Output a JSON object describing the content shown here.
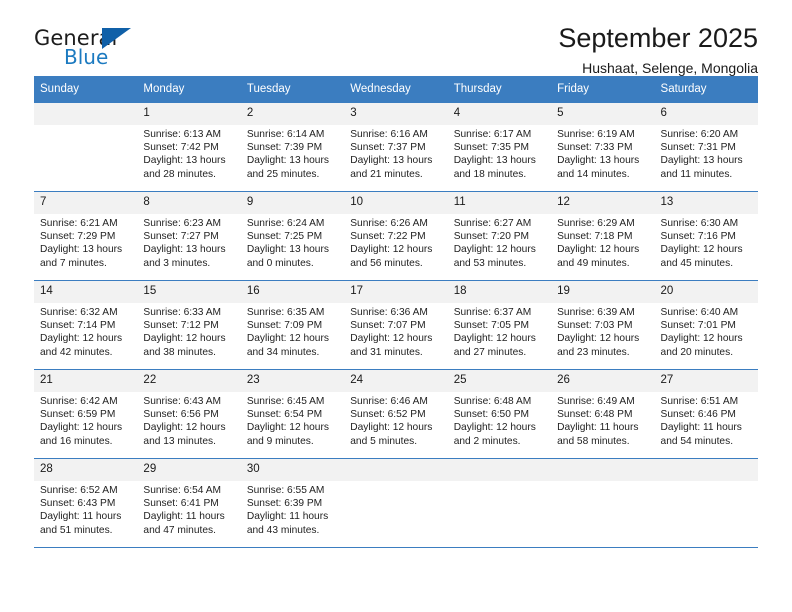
{
  "brand": {
    "name_top": "General",
    "name_bottom": "Blue",
    "accent_color": "#1c7ac0",
    "triangle_color": "#1060a8"
  },
  "header": {
    "title": "September 2025",
    "subtitle": "Hushaat, Selenge, Mongolia"
  },
  "theme": {
    "header_band": "#3b7dc0",
    "daynum_band": "#f2f2f2",
    "text": "#1a1a1a"
  },
  "calendar": {
    "weekday_headers": [
      "Sunday",
      "Monday",
      "Tuesday",
      "Wednesday",
      "Thursday",
      "Friday",
      "Saturday"
    ],
    "labels": {
      "sunrise": "Sunrise:",
      "sunset": "Sunset:",
      "daylight": "Daylight:"
    },
    "weeks": [
      [
        {
          "day": "",
          "empty": true
        },
        {
          "day": "1",
          "sunrise": "Sunrise: 6:13 AM",
          "sunset": "Sunset: 7:42 PM",
          "daylight_1": "Daylight: 13 hours",
          "daylight_2": "and 28 minutes."
        },
        {
          "day": "2",
          "sunrise": "Sunrise: 6:14 AM",
          "sunset": "Sunset: 7:39 PM",
          "daylight_1": "Daylight: 13 hours",
          "daylight_2": "and 25 minutes."
        },
        {
          "day": "3",
          "sunrise": "Sunrise: 6:16 AM",
          "sunset": "Sunset: 7:37 PM",
          "daylight_1": "Daylight: 13 hours",
          "daylight_2": "and 21 minutes."
        },
        {
          "day": "4",
          "sunrise": "Sunrise: 6:17 AM",
          "sunset": "Sunset: 7:35 PM",
          "daylight_1": "Daylight: 13 hours",
          "daylight_2": "and 18 minutes."
        },
        {
          "day": "5",
          "sunrise": "Sunrise: 6:19 AM",
          "sunset": "Sunset: 7:33 PM",
          "daylight_1": "Daylight: 13 hours",
          "daylight_2": "and 14 minutes."
        },
        {
          "day": "6",
          "sunrise": "Sunrise: 6:20 AM",
          "sunset": "Sunset: 7:31 PM",
          "daylight_1": "Daylight: 13 hours",
          "daylight_2": "and 11 minutes."
        }
      ],
      [
        {
          "day": "7",
          "sunrise": "Sunrise: 6:21 AM",
          "sunset": "Sunset: 7:29 PM",
          "daylight_1": "Daylight: 13 hours",
          "daylight_2": "and 7 minutes."
        },
        {
          "day": "8",
          "sunrise": "Sunrise: 6:23 AM",
          "sunset": "Sunset: 7:27 PM",
          "daylight_1": "Daylight: 13 hours",
          "daylight_2": "and 3 minutes."
        },
        {
          "day": "9",
          "sunrise": "Sunrise: 6:24 AM",
          "sunset": "Sunset: 7:25 PM",
          "daylight_1": "Daylight: 13 hours",
          "daylight_2": "and 0 minutes."
        },
        {
          "day": "10",
          "sunrise": "Sunrise: 6:26 AM",
          "sunset": "Sunset: 7:22 PM",
          "daylight_1": "Daylight: 12 hours",
          "daylight_2": "and 56 minutes."
        },
        {
          "day": "11",
          "sunrise": "Sunrise: 6:27 AM",
          "sunset": "Sunset: 7:20 PM",
          "daylight_1": "Daylight: 12 hours",
          "daylight_2": "and 53 minutes."
        },
        {
          "day": "12",
          "sunrise": "Sunrise: 6:29 AM",
          "sunset": "Sunset: 7:18 PM",
          "daylight_1": "Daylight: 12 hours",
          "daylight_2": "and 49 minutes."
        },
        {
          "day": "13",
          "sunrise": "Sunrise: 6:30 AM",
          "sunset": "Sunset: 7:16 PM",
          "daylight_1": "Daylight: 12 hours",
          "daylight_2": "and 45 minutes."
        }
      ],
      [
        {
          "day": "14",
          "sunrise": "Sunrise: 6:32 AM",
          "sunset": "Sunset: 7:14 PM",
          "daylight_1": "Daylight: 12 hours",
          "daylight_2": "and 42 minutes."
        },
        {
          "day": "15",
          "sunrise": "Sunrise: 6:33 AM",
          "sunset": "Sunset: 7:12 PM",
          "daylight_1": "Daylight: 12 hours",
          "daylight_2": "and 38 minutes."
        },
        {
          "day": "16",
          "sunrise": "Sunrise: 6:35 AM",
          "sunset": "Sunset: 7:09 PM",
          "daylight_1": "Daylight: 12 hours",
          "daylight_2": "and 34 minutes."
        },
        {
          "day": "17",
          "sunrise": "Sunrise: 6:36 AM",
          "sunset": "Sunset: 7:07 PM",
          "daylight_1": "Daylight: 12 hours",
          "daylight_2": "and 31 minutes."
        },
        {
          "day": "18",
          "sunrise": "Sunrise: 6:37 AM",
          "sunset": "Sunset: 7:05 PM",
          "daylight_1": "Daylight: 12 hours",
          "daylight_2": "and 27 minutes."
        },
        {
          "day": "19",
          "sunrise": "Sunrise: 6:39 AM",
          "sunset": "Sunset: 7:03 PM",
          "daylight_1": "Daylight: 12 hours",
          "daylight_2": "and 23 minutes."
        },
        {
          "day": "20",
          "sunrise": "Sunrise: 6:40 AM",
          "sunset": "Sunset: 7:01 PM",
          "daylight_1": "Daylight: 12 hours",
          "daylight_2": "and 20 minutes."
        }
      ],
      [
        {
          "day": "21",
          "sunrise": "Sunrise: 6:42 AM",
          "sunset": "Sunset: 6:59 PM",
          "daylight_1": "Daylight: 12 hours",
          "daylight_2": "and 16 minutes."
        },
        {
          "day": "22",
          "sunrise": "Sunrise: 6:43 AM",
          "sunset": "Sunset: 6:56 PM",
          "daylight_1": "Daylight: 12 hours",
          "daylight_2": "and 13 minutes."
        },
        {
          "day": "23",
          "sunrise": "Sunrise: 6:45 AM",
          "sunset": "Sunset: 6:54 PM",
          "daylight_1": "Daylight: 12 hours",
          "daylight_2": "and 9 minutes."
        },
        {
          "day": "24",
          "sunrise": "Sunrise: 6:46 AM",
          "sunset": "Sunset: 6:52 PM",
          "daylight_1": "Daylight: 12 hours",
          "daylight_2": "and 5 minutes."
        },
        {
          "day": "25",
          "sunrise": "Sunrise: 6:48 AM",
          "sunset": "Sunset: 6:50 PM",
          "daylight_1": "Daylight: 12 hours",
          "daylight_2": "and 2 minutes."
        },
        {
          "day": "26",
          "sunrise": "Sunrise: 6:49 AM",
          "sunset": "Sunset: 6:48 PM",
          "daylight_1": "Daylight: 11 hours",
          "daylight_2": "and 58 minutes."
        },
        {
          "day": "27",
          "sunrise": "Sunrise: 6:51 AM",
          "sunset": "Sunset: 6:46 PM",
          "daylight_1": "Daylight: 11 hours",
          "daylight_2": "and 54 minutes."
        }
      ],
      [
        {
          "day": "28",
          "sunrise": "Sunrise: 6:52 AM",
          "sunset": "Sunset: 6:43 PM",
          "daylight_1": "Daylight: 11 hours",
          "daylight_2": "and 51 minutes."
        },
        {
          "day": "29",
          "sunrise": "Sunrise: 6:54 AM",
          "sunset": "Sunset: 6:41 PM",
          "daylight_1": "Daylight: 11 hours",
          "daylight_2": "and 47 minutes."
        },
        {
          "day": "30",
          "sunrise": "Sunrise: 6:55 AM",
          "sunset": "Sunset: 6:39 PM",
          "daylight_1": "Daylight: 11 hours",
          "daylight_2": "and 43 minutes."
        },
        {
          "day": "",
          "empty": true
        },
        {
          "day": "",
          "empty": true
        },
        {
          "day": "",
          "empty": true
        },
        {
          "day": "",
          "empty": true
        }
      ]
    ]
  }
}
